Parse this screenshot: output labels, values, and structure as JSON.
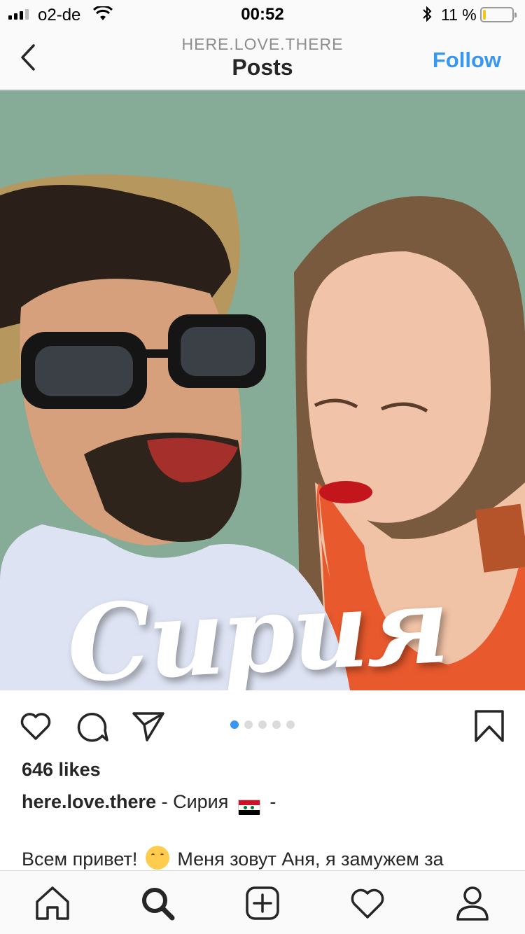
{
  "status_bar": {
    "carrier": "o2-de",
    "time": "00:52",
    "battery_percent": "11 %",
    "battery_level": 0.11
  },
  "header": {
    "username": "HERE.LOVE.THERE",
    "title": "Posts",
    "follow_label": "Follow",
    "accent_color": "#3897f0"
  },
  "post": {
    "image_overlay_text": "Сирия",
    "carousel": {
      "count": 5,
      "active_index": 0
    },
    "likes": "646 likes",
    "caption": {
      "username": "here.love.there",
      "text": " - Сирия ",
      "flag": "syria-flag-icon",
      "suffix": " -"
    },
    "body": {
      "before_emoji": "Всем привет! ",
      "emoji": "hugging-face-icon",
      "after_emoji": " Меня зовут Аня, я замужем за"
    }
  },
  "icons": {
    "back": "chevron-left-icon",
    "like": "heart-icon",
    "comment": "comment-icon",
    "share": "send-icon",
    "save": "bookmark-icon"
  },
  "tabbar": [
    "home-icon",
    "search-icon",
    "add-post-icon",
    "activity-heart-icon",
    "profile-icon"
  ]
}
